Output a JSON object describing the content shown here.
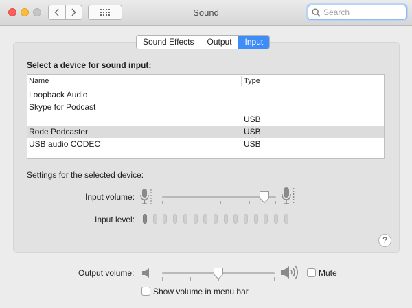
{
  "window": {
    "title": "Sound"
  },
  "toolbar": {
    "search_placeholder": "Search"
  },
  "tabs": [
    {
      "label": "Sound Effects",
      "selected": false
    },
    {
      "label": "Output",
      "selected": false
    },
    {
      "label": "Input",
      "selected": true
    }
  ],
  "input_panel": {
    "section_title": "Select a device for sound input:",
    "table": {
      "columns": [
        "Name",
        "Type"
      ],
      "rows": [
        {
          "name": "Loopback Audio",
          "type": ""
        },
        {
          "name": "Skype for Podcast",
          "type": ""
        },
        {
          "name": "",
          "type": "USB"
        },
        {
          "name": "Rode Podcaster",
          "type": "USB",
          "selected": true
        },
        {
          "name": "USB audio CODEC",
          "type": "USB"
        }
      ]
    },
    "settings_label": "Settings for the selected device:",
    "input_volume_label": "Input volume:",
    "input_volume_fraction": 0.9,
    "input_level_label": "Input level:",
    "input_level_total": 15,
    "input_level_lit": 1
  },
  "output": {
    "volume_label": "Output volume:",
    "volume_fraction": 0.5,
    "mute_label": "Mute",
    "mute_checked": false,
    "show_volume_label": "Show volume in menu bar",
    "show_volume_checked": false
  },
  "help": {
    "label": "?"
  },
  "colors": {
    "accent": "#3d8cf7",
    "selected_row": "#dcdcdc",
    "panel": "#e2e2e2"
  },
  "icons": [
    "back-arrow-icon",
    "forward-arrow-icon",
    "show-all-grid-icon",
    "search-icon",
    "microphone-low-icon",
    "microphone-high-icon",
    "speaker-low-icon",
    "speaker-high-icon"
  ]
}
